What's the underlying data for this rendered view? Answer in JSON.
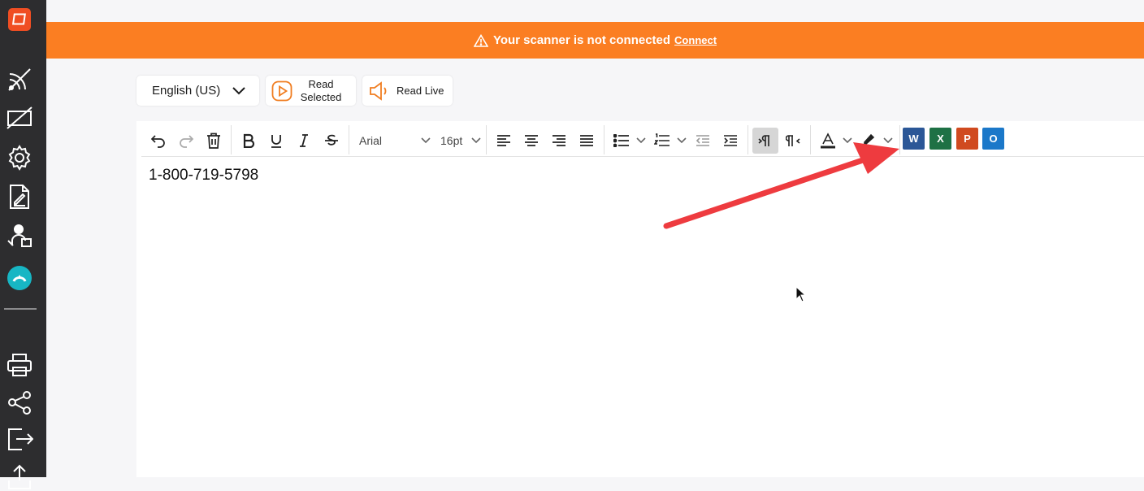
{
  "banner": {
    "message": "Your scanner is not connected",
    "link": "Connect"
  },
  "controls": {
    "language": "English (US)",
    "read_selected": "Read Selected",
    "read_live": "Read Live"
  },
  "toolbar": {
    "font": "Arial",
    "size": "16pt"
  },
  "document": {
    "text": "1-800-719-5798"
  },
  "colors": {
    "accent": "#fb7e22",
    "sidebar": "#2d2d2f",
    "logo": "#f04e23",
    "teal": "#17b6c4",
    "arrow": "#ee3b3f"
  }
}
